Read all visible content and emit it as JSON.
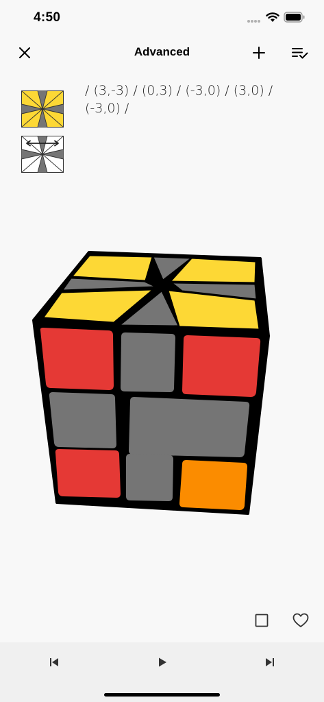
{
  "status": {
    "time": "4:50"
  },
  "nav": {
    "title": "Advanced",
    "close_icon": "close-icon",
    "add_icon": "plus-icon",
    "list_icon": "checklist-icon"
  },
  "algorithm": {
    "notation": "/ (3,-3) / (0,3) / (-3,0) / (3,0) / (-3,0) /"
  },
  "colors": {
    "yellow": "#fdd835",
    "red": "#e53935",
    "orange": "#fb8c00",
    "gray": "#757575",
    "white": "#ffffff",
    "black": "#000000"
  },
  "actions": {
    "square_icon": "square-outline-icon",
    "favorite_icon": "heart-outline-icon"
  },
  "player": {
    "previous_icon": "skip-previous-icon",
    "play_icon": "play-icon",
    "next_icon": "skip-next-icon"
  }
}
